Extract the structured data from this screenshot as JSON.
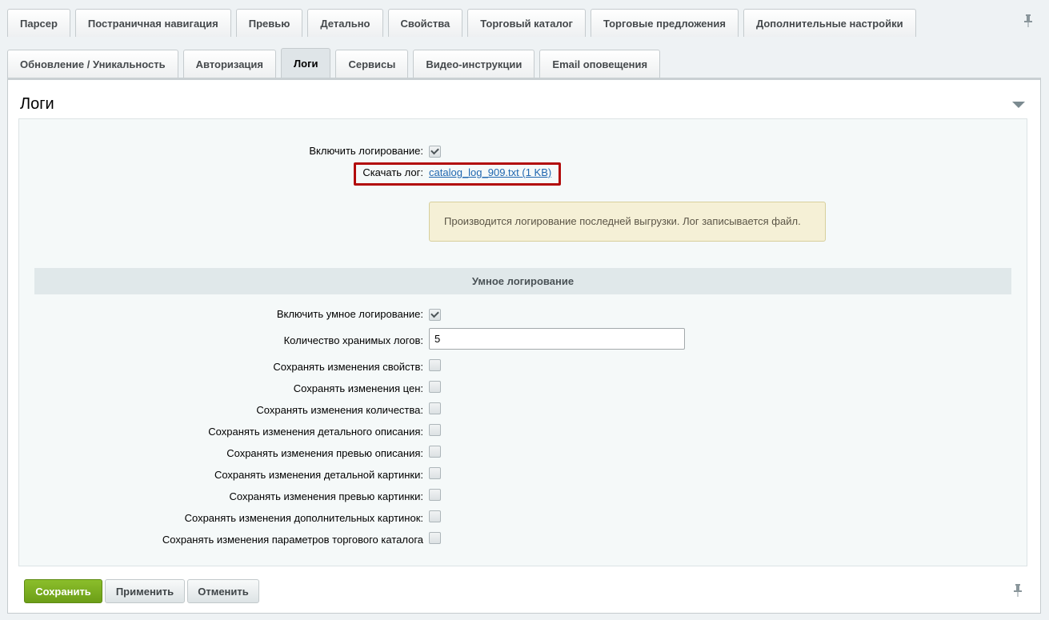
{
  "tabs_row1": [
    "Парсер",
    "Постраничная навигация",
    "Превью",
    "Детально",
    "Свойства",
    "Торговый каталог",
    "Торговые предложения",
    "Дополнительные настройки"
  ],
  "tabs_row2": [
    "Обновление / Уникальность",
    "Авторизация",
    "Логи",
    "Сервисы",
    "Видео-инструкции",
    "Email оповещения"
  ],
  "active_tab": "Логи",
  "panel": {
    "title": "Логи"
  },
  "logging": {
    "enable_label": "Включить логирование:",
    "enable_checked": true,
    "download_label": "Скачать лог:",
    "download_link": "catalog_log_909.txt (1 KB)",
    "note": "Производится логирование последней выгрузки. Лог записывается файл."
  },
  "smart": {
    "section_title": "Умное логирование",
    "enable_label": "Включить умное логирование:",
    "enable_checked": true,
    "count_label": "Количество хранимых логов:",
    "count_value": "5",
    "options": [
      {
        "label": "Сохранять изменения свойств:",
        "checked": false
      },
      {
        "label": "Сохранять изменения цен:",
        "checked": false
      },
      {
        "label": "Сохранять изменения количества:",
        "checked": false
      },
      {
        "label": "Сохранять изменения детального описания:",
        "checked": false
      },
      {
        "label": "Сохранять изменения превью описания:",
        "checked": false
      },
      {
        "label": "Сохранять изменения детальной картинки:",
        "checked": false
      },
      {
        "label": "Сохранять изменения превью картинки:",
        "checked": false
      },
      {
        "label": "Сохранять изменения дополнительных картинок:",
        "checked": false
      },
      {
        "label": "Сохранять изменения параметров торгового каталога",
        "checked": false
      }
    ]
  },
  "buttons": {
    "save": "Сохранить",
    "apply": "Применить",
    "cancel": "Отменить"
  },
  "colors": {
    "highlight_border": "#b20b0b",
    "save_button": "#7aae20",
    "link": "#2067b0"
  }
}
